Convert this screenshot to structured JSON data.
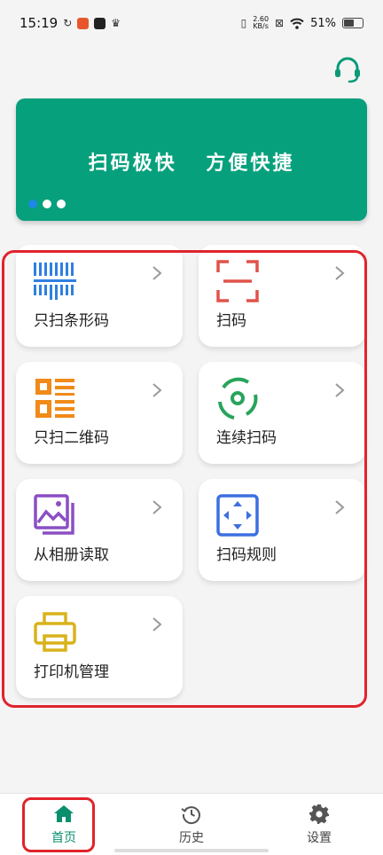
{
  "status_bar": {
    "time": "15:19",
    "net_speed_value": "2.60",
    "net_speed_unit": "KB/s",
    "battery": "51%"
  },
  "banner": {
    "text": "扫码极快 方便快捷",
    "dots": 3,
    "active_dot": 0
  },
  "actions": [
    {
      "label": "只扫条形码",
      "icon": "barcode-icon",
      "color": "#2f7fe0"
    },
    {
      "label": "扫码",
      "icon": "scan-frame-icon",
      "color": "#e0524a"
    },
    {
      "label": "只扫二维码",
      "icon": "qr-code-icon",
      "color": "#f08a18"
    },
    {
      "label": "连续扫码",
      "icon": "continuous-scan-icon",
      "color": "#27a45a"
    },
    {
      "label": "从相册读取",
      "icon": "gallery-icon",
      "color": "#8a4fc4"
    },
    {
      "label": "扫码规则",
      "icon": "scan-rule-icon",
      "color": "#3d6fe0"
    },
    {
      "label": "打印机管理",
      "icon": "printer-icon",
      "color": "#d9b21a"
    }
  ],
  "bottom_nav": {
    "home": "首页",
    "history": "历史",
    "settings": "设置"
  },
  "colors": {
    "brand_green": "#06a07c",
    "nav_active": "#0a8f6e",
    "highlight": "#e0242c"
  }
}
